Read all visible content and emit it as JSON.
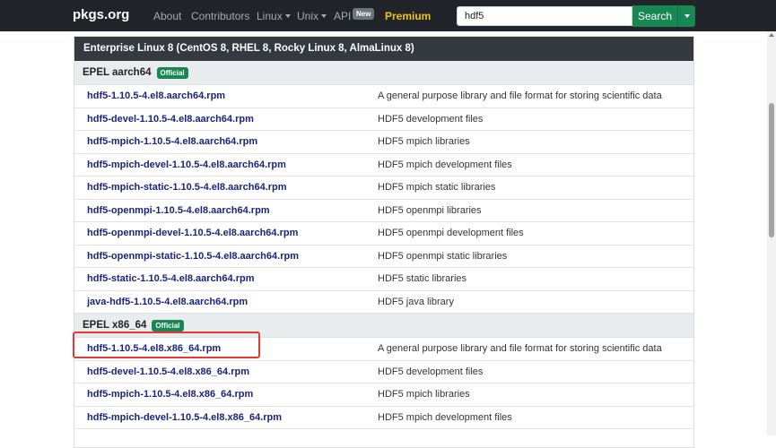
{
  "navbar": {
    "brand": "pkgs.org",
    "about": "About",
    "contributors": "Contributors",
    "linux": "Linux",
    "unix": "Unix",
    "api": "API",
    "api_badge": "New",
    "premium": "Premium",
    "search_value": "hdf5",
    "search_button": "Search"
  },
  "distro": {
    "title": "Enterprise Linux 8 (CentOS 8, RHEL 8, Rocky Linux 8, AlmaLinux 8)",
    "sections": [
      {
        "name": "EPEL aarch64",
        "badge": "Official",
        "rows": [
          {
            "pkg": "hdf5-1.10.5-4.el8.aarch64.rpm",
            "desc": "A general purpose library and file format for storing scientific data"
          },
          {
            "pkg": "hdf5-devel-1.10.5-4.el8.aarch64.rpm",
            "desc": "HDF5 development files"
          },
          {
            "pkg": "hdf5-mpich-1.10.5-4.el8.aarch64.rpm",
            "desc": "HDF5 mpich libraries"
          },
          {
            "pkg": "hdf5-mpich-devel-1.10.5-4.el8.aarch64.rpm",
            "desc": "HDF5 mpich development files"
          },
          {
            "pkg": "hdf5-mpich-static-1.10.5-4.el8.aarch64.rpm",
            "desc": "HDF5 mpich static libraries"
          },
          {
            "pkg": "hdf5-openmpi-1.10.5-4.el8.aarch64.rpm",
            "desc": "HDF5 openmpi libraries"
          },
          {
            "pkg": "hdf5-openmpi-devel-1.10.5-4.el8.aarch64.rpm",
            "desc": "HDF5 openmpi development files"
          },
          {
            "pkg": "hdf5-openmpi-static-1.10.5-4.el8.aarch64.rpm",
            "desc": "HDF5 openmpi static libraries"
          },
          {
            "pkg": "hdf5-static-1.10.5-4.el8.aarch64.rpm",
            "desc": "HDF5 static libraries"
          },
          {
            "pkg": "java-hdf5-1.10.5-4.el8.aarch64.rpm",
            "desc": "HDF5 java library"
          }
        ]
      },
      {
        "name": "EPEL x86_64",
        "badge": "Official",
        "rows": [
          {
            "pkg": "hdf5-1.10.5-4.el8.x86_64.rpm",
            "desc": "A general purpose library and file format for storing scientific data"
          },
          {
            "pkg": "hdf5-devel-1.10.5-4.el8.x86_64.rpm",
            "desc": "HDF5 development files"
          },
          {
            "pkg": "hdf5-mpich-1.10.5-4.el8.x86_64.rpm",
            "desc": "HDF5 mpich libraries"
          },
          {
            "pkg": "hdf5-mpich-devel-1.10.5-4.el8.x86_64.rpm",
            "desc": "HDF5 mpich development files"
          }
        ]
      }
    ]
  },
  "colors": {
    "navbar_bg": "#212529",
    "premium": "#f0c419",
    "success": "#198754",
    "link": "#1a237e",
    "highlight": "#e53935"
  }
}
